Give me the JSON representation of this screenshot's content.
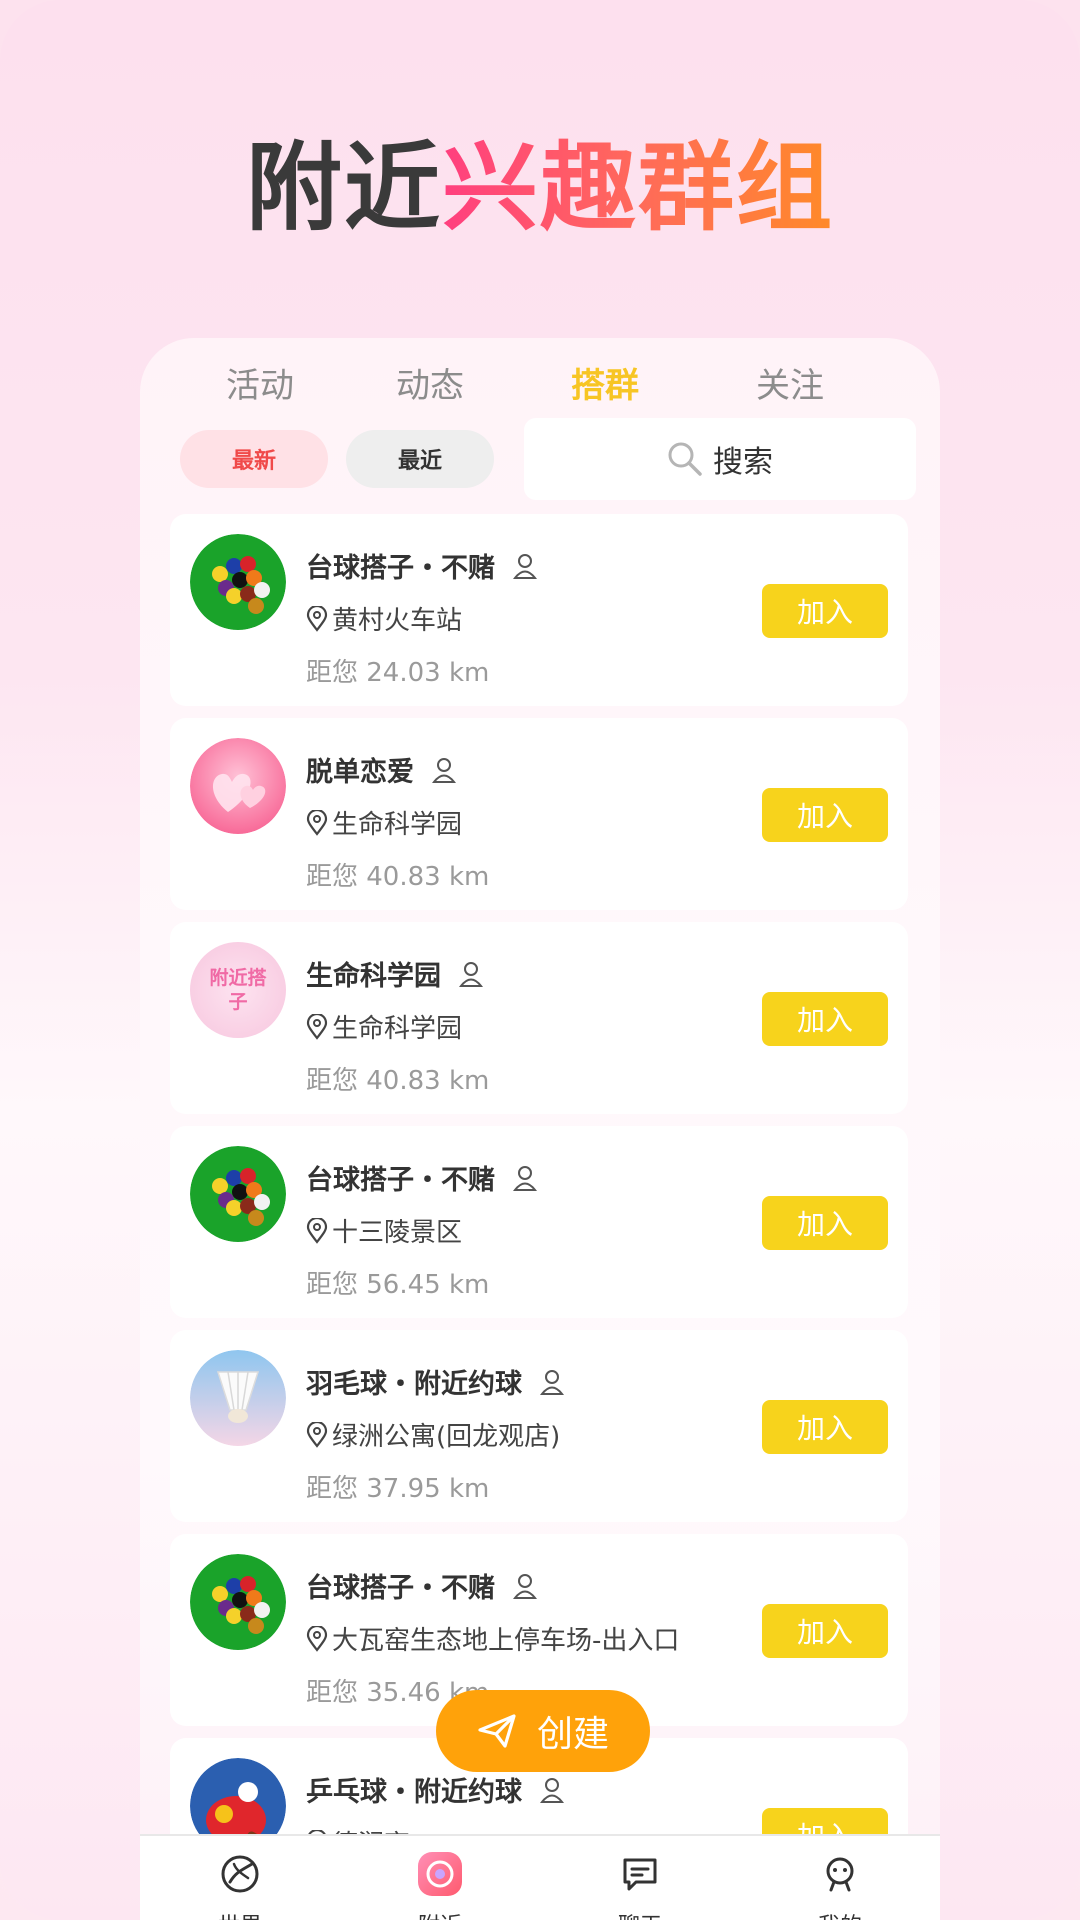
{
  "hero": {
    "title_dark": "附近",
    "title_color": "兴趣群组"
  },
  "tabs": [
    {
      "label": "活动",
      "active": false
    },
    {
      "label": "动态",
      "active": false
    },
    {
      "label": "搭群",
      "active": true
    },
    {
      "label": "关注",
      "active": false
    }
  ],
  "filters": {
    "newest": "最新",
    "recent": "最近"
  },
  "search": {
    "label": "搜索"
  },
  "groups": [
    {
      "name": "台球搭子・不赌",
      "location": "黄村火车站",
      "distance": "距您 24.03 km",
      "join": "加入",
      "avatar": "billiards"
    },
    {
      "name": "脱单恋爱",
      "location": "生命科学园",
      "distance": "距您 40.83 km",
      "join": "加入",
      "avatar": "hearts"
    },
    {
      "name": "生命科学园",
      "location": "生命科学园",
      "distance": "距您 40.83 km",
      "join": "加入",
      "avatar": "nearby-badge",
      "avatar_text": "附近搭子"
    },
    {
      "name": "台球搭子・不赌",
      "location": "十三陵景区",
      "distance": "距您 56.45 km",
      "join": "加入",
      "avatar": "billiards"
    },
    {
      "name": "羽毛球・附近约球",
      "location": "绿洲公寓(回龙观店)",
      "distance": "距您 37.95 km",
      "join": "加入",
      "avatar": "shuttlecock"
    },
    {
      "name": "台球搭子・不赌",
      "location": "大瓦窑生态地上停车场-出入口",
      "distance": "距您 35.46 km",
      "join": "加入",
      "avatar": "billiards"
    },
    {
      "name": "乒乓球・附近约球",
      "location": "德润斋",
      "distance": "",
      "join": "加入",
      "avatar": "pingpong"
    }
  ],
  "fab": {
    "label": "创建"
  },
  "nav": [
    {
      "label": "世界",
      "icon": "planet-icon"
    },
    {
      "label": "附近",
      "icon": "nearby-icon"
    },
    {
      "label": "聊天",
      "icon": "chat-icon"
    },
    {
      "label": "我的",
      "icon": "profile-icon"
    }
  ],
  "colors": {
    "accent": "#f7d31c",
    "tab_active": "#f7c524",
    "fab": "#ffa20a"
  }
}
